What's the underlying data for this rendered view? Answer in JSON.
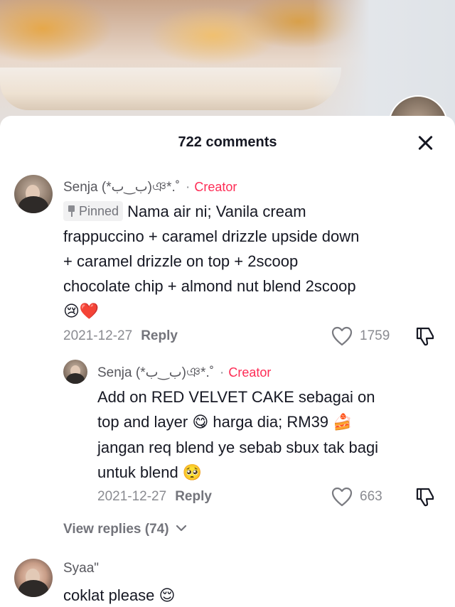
{
  "sheet": {
    "count_label": "722 comments"
  },
  "comments": [
    {
      "username": "Senja (*ب‿ب)ঞ*.˚",
      "creator_tag": "Creator",
      "separator": "·",
      "pinned_label": "Pinned",
      "text": "Nama air ni; Vanila cream frappuccino + caramel drizzle upside down + caramel drizzle on top + 2scoop chocolate chip + almond nut blend 2scoop",
      "emojis": "😢❤️",
      "date": "2021-12-27",
      "reply_label": "Reply",
      "likes": "1759"
    },
    {
      "username": "Senja (*ب‿ب)ঞ*.˚",
      "creator_tag": "Creator",
      "separator": "·",
      "text_part1": "Add on RED VELVET CAKE sebagai on top and layer",
      "emoji1": "😋",
      "text_part2": "harga dia; RM39",
      "emoji2": "🍰",
      "text_part3": "jangan req blend ye sebab sbux tak bagi untuk blend",
      "emoji3": "🥺",
      "date": "2021-12-27",
      "reply_label": "Reply",
      "likes": "663"
    },
    {
      "username": "Syaa\"",
      "text": "coklat please",
      "emoji": "😌"
    }
  ],
  "view_replies_label": "View replies (74)",
  "colors": {
    "creator": "#fe2c55",
    "text": "#161823",
    "muted": "#8a8b91"
  },
  "icons": [
    "close-icon",
    "heart-icon",
    "dislike-icon",
    "pin-icon",
    "chevron-down-icon"
  ]
}
